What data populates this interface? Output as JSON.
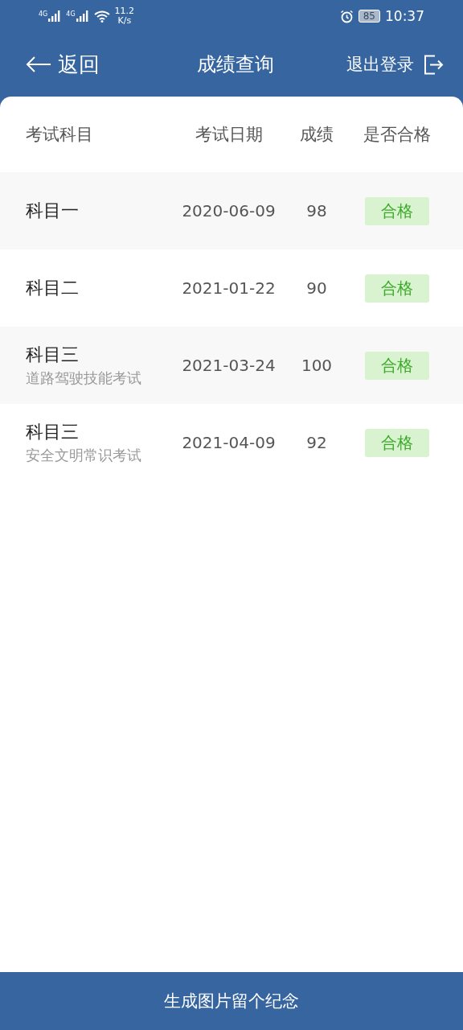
{
  "status_bar": {
    "signals": [
      {
        "label": "4G"
      },
      {
        "label": "4G"
      }
    ],
    "speed": [
      "11.2",
      "K/s"
    ],
    "battery": "85",
    "time": "10:37"
  },
  "header": {
    "back": "返回",
    "title": "成绩查询",
    "logout": "退出登录"
  },
  "table": {
    "columns": [
      "考试科目",
      "考试日期",
      "成绩",
      "是否合格"
    ],
    "rows": [
      {
        "subject": "科目一",
        "date": "2020-06-09",
        "score": "98",
        "result": "合格",
        "passed": true
      },
      {
        "subject": "科目二",
        "date": "2021-01-22",
        "score": "90",
        "result": "合格",
        "passed": true
      },
      {
        "subject": "科目三",
        "detail": "道路驾驶技能考试",
        "date": "2021-03-24",
        "score": "100",
        "result": "合格",
        "passed": true
      },
      {
        "subject": "科目三",
        "detail": "安全文明常识考试",
        "date": "2021-04-09",
        "score": "92",
        "result": "合格",
        "passed": true
      }
    ]
  },
  "footer_button": "生成图片留个纪念"
}
